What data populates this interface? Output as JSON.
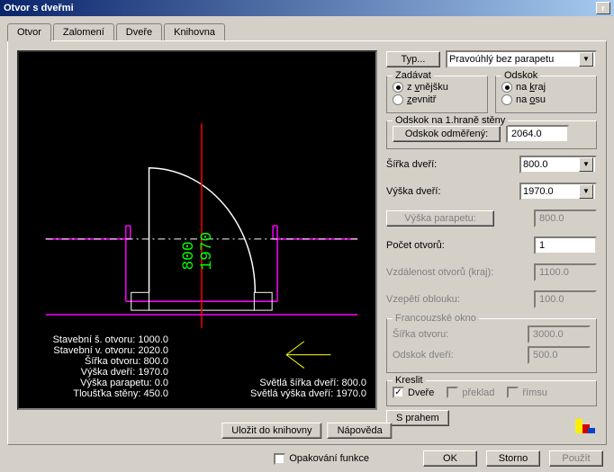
{
  "window": {
    "title": "Otvor s dveřmi"
  },
  "tabs": [
    "Otvor",
    "Zalomení",
    "Dveře",
    "Knihovna"
  ],
  "active_tab": 0,
  "preview": {
    "green1": "800",
    "green2": "1970",
    "info_left": [
      "Stavební š. otvoru: 1000.0",
      "Stavební v. otvoru: 2020.0",
      "Šířka otvoru: 800.0",
      "Výška dveří: 1970.0",
      "Výška parapetu: 0.0",
      "Tloušťka stěny: 450.0"
    ],
    "info_right": [
      "Světlá šířka dveří: 800.0",
      "Světlá výška dveří: 1970.0"
    ]
  },
  "buttons": {
    "typ": "Typ...",
    "typ_value": "Pravoúhlý bez parapetu",
    "odskok": "Odskok odměřený:",
    "vyska_parapetu": "Výška parapetu:",
    "s_prahem": "S prahem",
    "ulozit": "Uložit do knihovny",
    "napoveda": "Nápověda",
    "ok": "OK",
    "storno": "Storno",
    "pouzit": "Použít"
  },
  "groups": {
    "zadavat": {
      "legend": "Zadávat",
      "opt1": "z vnějšku",
      "opt2": "zevnitř"
    },
    "odskok": {
      "legend": "Odskok",
      "opt1": "na kraj",
      "opt2": "na osu"
    },
    "odskok_hrana": {
      "legend": "Odskok na 1.hraně stěny"
    },
    "francouzske": {
      "legend": "Francouzské okno",
      "sirka": "Šířka otvoru:",
      "odskok": "Odskok dveří:"
    },
    "kreslit": {
      "legend": "Kreslit",
      "dvere": "Dveře",
      "preklad": "překlad",
      "rimsu": "římsu"
    }
  },
  "fields": {
    "odskok_value": "2064.0",
    "sirka_dveri": {
      "label": "Šířka dveří:",
      "value": "800.0"
    },
    "vyska_dveri": {
      "label": "Výška dveří:",
      "value": "1970.0"
    },
    "vyska_parapetu_value": "800.0",
    "pocet_otvoru": {
      "label": "Počet otvorů:",
      "value": "1"
    },
    "vzdalenost": {
      "label": "Vzdálenost otvorů (kraj):",
      "value": "1100.0"
    },
    "vzepeti": {
      "label": "Vzepětí oblouku:",
      "value": "100.0"
    },
    "fr_sirka": "3000.0",
    "fr_odskok": "500.0"
  },
  "footer": {
    "opakovani": "Opakování funkce"
  }
}
